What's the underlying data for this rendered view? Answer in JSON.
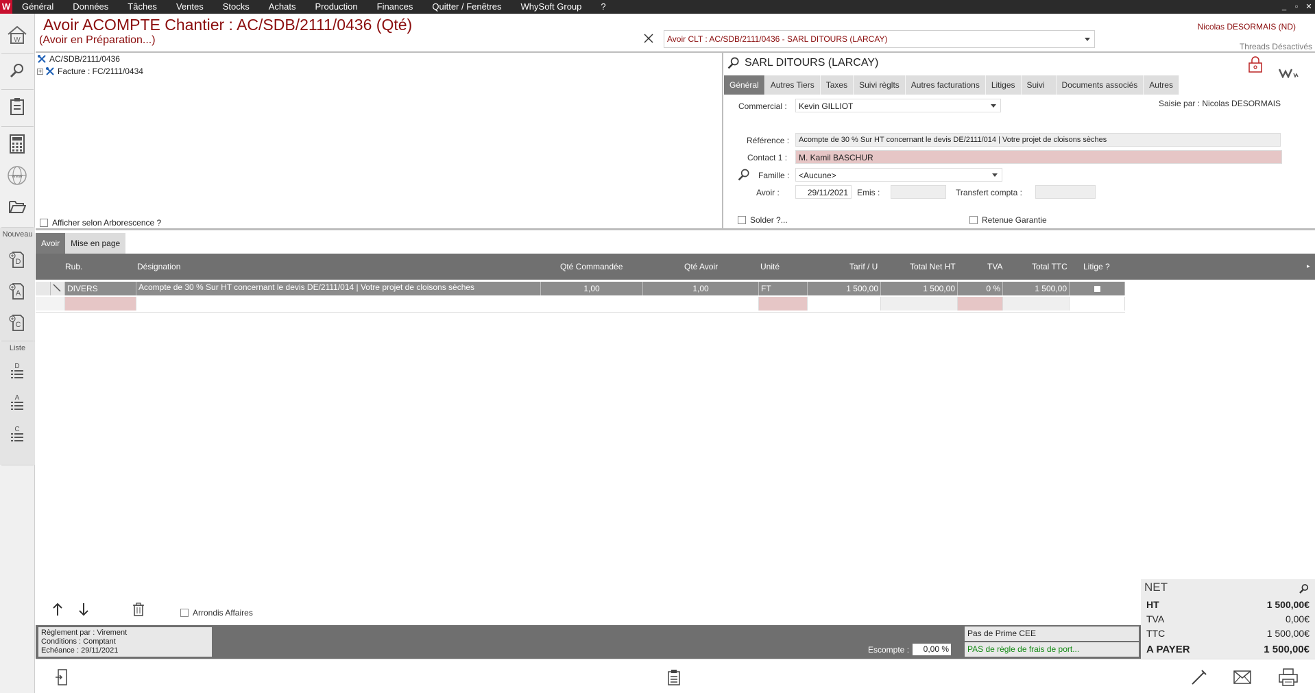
{
  "app": {
    "logo": "W"
  },
  "menu": [
    "Général",
    "Données",
    "Tâches",
    "Ventes",
    "Stocks",
    "Achats",
    "Production",
    "Finances",
    "Quitter / Fenêtres",
    "WhySoft Group",
    "?"
  ],
  "window_controls": {
    "minimize": "_",
    "restore": "▫",
    "close": "✕"
  },
  "sidebar": {
    "nouveau_label": "Nouveau",
    "liste_label": "Liste",
    "items": [
      "home-icon",
      "search-icon",
      "clipboard-icon",
      "calculator-icon",
      "globe-www-icon",
      "folder-open-icon"
    ],
    "new_items": [
      "D",
      "A",
      "C"
    ],
    "list_items": [
      "D",
      "A",
      "C"
    ]
  },
  "header": {
    "title": "Avoir ACOMPTE Chantier : AC/SDB/2111/0436 (Qté)",
    "subtitle": "(Avoir en Préparation...)",
    "doc_select": "Avoir CLT : AC/SDB/2111/0436 - SARL DITOURS  (LARCAY)",
    "user": "Nicolas DESORMAIS (ND)",
    "threads": "Threads Désactivés"
  },
  "tree": {
    "root": "AC/SDB/2111/0436",
    "child": "Facture : FC/2111/0434",
    "expand": "+",
    "checkbox_label": "Afficher selon Arborescence ?"
  },
  "client": {
    "name": "SARL DITOURS  (LARCAY)",
    "tabs": [
      "Général",
      "Autres Tiers",
      "Taxes",
      "Suivi règlts",
      "Autres facturations",
      "Litiges",
      "Suivi",
      "Documents associés",
      "Autres"
    ],
    "active_tab": "Général",
    "saisie_par": "Saisie par : Nicolas DESORMAIS",
    "commercial_label": "Commercial :",
    "commercial": "Kevin GILLIOT",
    "reference_label": "Référence :",
    "reference": "Acompte de 30 % Sur HT concernant le devis DE/2111/014 | Votre projet de cloisons sèches",
    "contact_label": "Contact 1 :",
    "contact": "M. Kamil BASCHUR",
    "famille_label": "Famille :",
    "famille": "<Aucune>",
    "avoir_label": "Avoir :",
    "avoir_date": "29/11/2021",
    "emis_label": "Emis :",
    "emis": "",
    "transfert_label": "Transfert compta :",
    "transfert": "",
    "solder_label": "Solder ?...",
    "retenue_label": "Retenue Garantie"
  },
  "lower_tabs": [
    "Avoir",
    "Mise en page"
  ],
  "grid": {
    "headers": [
      "Rub.",
      "Désignation",
      "Qté Commandée",
      "Qté Avoir",
      "Unité",
      "Tarif / U",
      "Total Net HT",
      "TVA",
      "Total TTC",
      "Litige ?"
    ],
    "rows": [
      {
        "rub": "DIVERS",
        "designation": "Acompte de 30 % Sur HT concernant le devis DE/2111/014 | Votre projet de cloisons sèches",
        "qte_cmd": "1,00",
        "qte_avoir": "1,00",
        "unite": "FT",
        "tarif": "1 500,00",
        "total_ht": "1 500,00",
        "tva": "0 %",
        "total_ttc": "1 500,00",
        "litige": false
      }
    ]
  },
  "footer": {
    "arrondis_label": "Arrondis Affaires",
    "reglement": "Règlement par : Virement",
    "conditions": "Conditions : Comptant",
    "echeance": "Echéance : 29/11/2021",
    "escompte_label": "Escompte :",
    "escompte": "0,00 %",
    "prime": "Pas de Prime CEE",
    "port": "PAS de règle de frais de port..."
  },
  "totals": {
    "net_label": "NET",
    "ht_label": "HT",
    "ht": "1 500,00€",
    "tva_label": "TVA",
    "tva": "0,00€",
    "ttc_label": "TTC",
    "ttc": "1 500,00€",
    "apayer_label": "A PAYER",
    "apayer": "1 500,00€"
  },
  "colors": {
    "accent": "#8b0d0d",
    "menubar": "#2b2b2b",
    "grid_header": "#707070",
    "pink_field": "#e6c6c6",
    "green_text": "#138a13"
  }
}
